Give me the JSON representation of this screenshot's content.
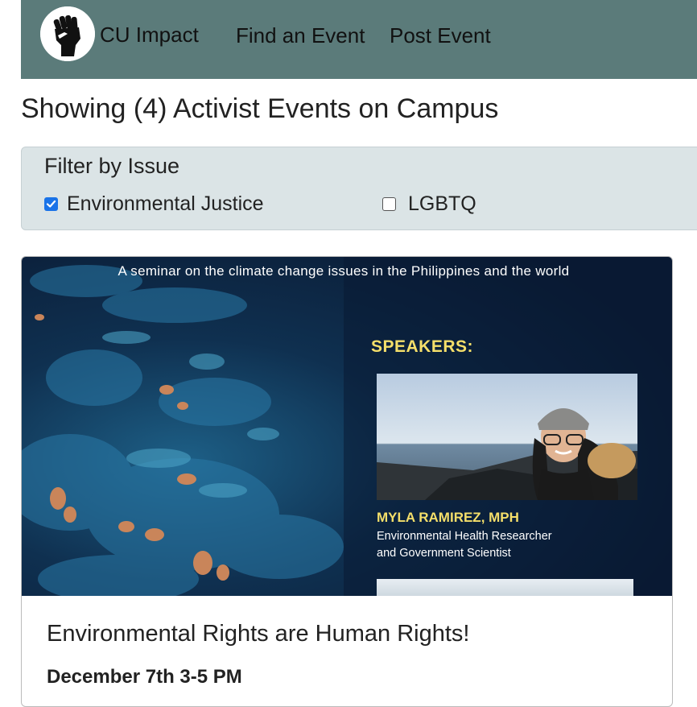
{
  "nav": {
    "brand": "CU Impact",
    "links": [
      "Find an Event",
      "Post Event"
    ],
    "logo_icon": "raised-fist-icon"
  },
  "page": {
    "heading": "Showing (4) Activist Events on Campus"
  },
  "filter": {
    "title": "Filter by Issue",
    "options": [
      {
        "label": "Environmental Justice",
        "checked": true
      },
      {
        "label": "LGBTQ",
        "checked": false
      }
    ]
  },
  "events": [
    {
      "poster": {
        "caption": "A seminar on the climate change issues in the Philippines and the world",
        "speakers_label": "SPEAKERS:",
        "speaker_name": "MYLA RAMIREZ, MPH",
        "speaker_role_line1": "Environmental Health Researcher",
        "speaker_role_line2": "and Government Scientist"
      },
      "title": "Environmental Rights are Human Rights!",
      "date": "December 7th 3-5 PM"
    }
  ],
  "colors": {
    "navbar": "#5b7b7a",
    "filter_bg": "#dbe4e6",
    "checkbox_checked": "#1a73e8",
    "poster_accent": "#f5df6a"
  }
}
